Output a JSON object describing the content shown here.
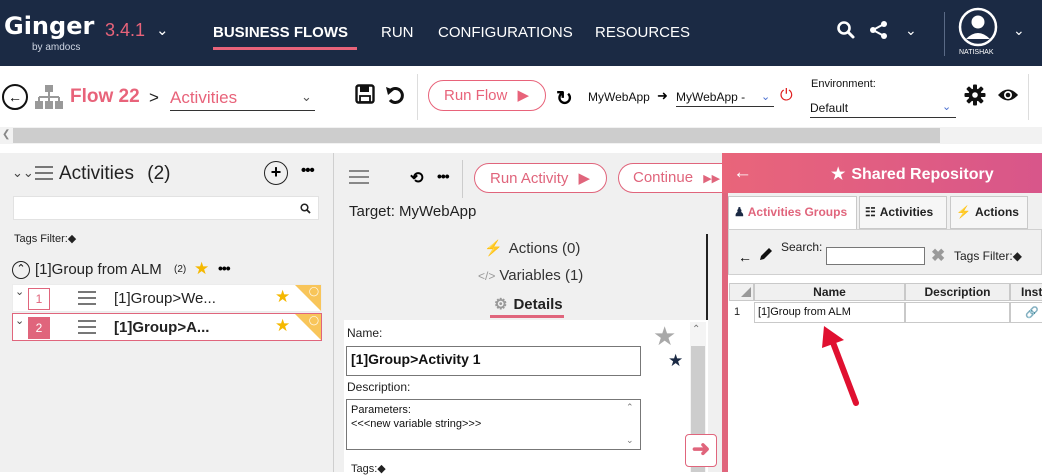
{
  "app": {
    "name": "Ginger",
    "subtitle": "by amdocs",
    "version": "3.4.1"
  },
  "nav": {
    "items": [
      "BUSINESS FLOWS",
      "RUN",
      "CONFIGURATIONS",
      "RESOURCES"
    ],
    "user": "NATISHAK"
  },
  "toolbar": {
    "flow_name": "Flow 22",
    "breadcrumb_sep": ">",
    "breadcrumb_current": "Activities",
    "run_flow_label": "Run Flow",
    "target_app": "MyWebApp",
    "target_app_select": "MyWebApp -",
    "environment_label": "Environment:",
    "environment_value": "Default"
  },
  "left_panel": {
    "title": "Activities",
    "count": "(2)",
    "tags_filter": "Tags Filter:",
    "group": {
      "title": "[1]Group from ALM",
      "count": "(2)"
    },
    "activities": [
      {
        "index": "1",
        "label": "[1]Group>We...",
        "selected": false
      },
      {
        "index": "2",
        "label": "[1]Group>A...",
        "selected": true
      }
    ]
  },
  "mid_panel": {
    "run_activity_label": "Run Activity",
    "continue_label": "Continue",
    "target": "Target: MyWebApp",
    "actions_link": "Actions (0)",
    "variables_link": "Variables (1)",
    "details_link": "Details",
    "name_label": "Name:",
    "name_value": "[1]Group>Activity 1",
    "description_label": "Description:",
    "description_line1": "Parameters:",
    "description_line2": "<<<new variable string>>>",
    "tags_label": "Tags:"
  },
  "repository": {
    "title": "Shared Repository",
    "tabs": [
      "Activities Groups",
      "Activities",
      "Actions"
    ],
    "search_label": "Search:",
    "tags_filter": "Tags Filter:",
    "columns": [
      "Name",
      "Description",
      "Inst"
    ],
    "rows": [
      {
        "index": "1",
        "name": "[1]Group from ALM",
        "description": ""
      }
    ]
  },
  "colors": {
    "accent": "#e0657c",
    "nav_bg": "#1b2a44",
    "star": "#f5b800",
    "arrow": "#e01030"
  }
}
